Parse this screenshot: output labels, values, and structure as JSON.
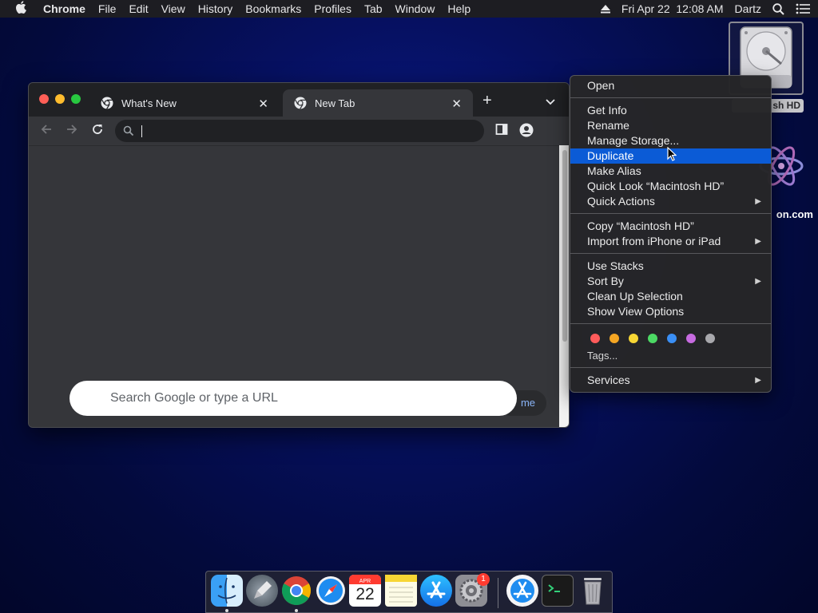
{
  "menubar": {
    "app_name": "Chrome",
    "items": [
      "File",
      "Edit",
      "View",
      "History",
      "Bookmarks",
      "Profiles",
      "Tab",
      "Window",
      "Help"
    ],
    "clock": "Fri Apr 22  12:08 AM",
    "user": "Dartz"
  },
  "desktop": {
    "hd_label": "sh HD",
    "atom_label": "on.com"
  },
  "chrome": {
    "tabs": [
      {
        "title": "What's New",
        "close": "✕"
      },
      {
        "title": "New Tab",
        "close": "✕"
      }
    ],
    "new_tab_symbol": "+",
    "omnibox_value": "",
    "ntp_search_placeholder": "Search Google or type a URL",
    "customize_text": "me"
  },
  "context_menu": {
    "group1": [
      "Open"
    ],
    "group2": [
      "Get Info",
      "Rename",
      "Manage Storage...",
      "Duplicate",
      "Make Alias",
      "Quick Look “Macintosh HD”",
      "Quick Actions"
    ],
    "group3": [
      "Copy “Macintosh HD”",
      "Import from iPhone or iPad"
    ],
    "group4": [
      "Use Stacks",
      "Sort By",
      "Clean Up Selection",
      "Show View Options"
    ],
    "tags_label": "Tags...",
    "services_label": "Services",
    "highlighted": "Duplicate",
    "tag_colors": [
      "#ff5b5b",
      "#f5a623",
      "#f7d634",
      "#4cd964",
      "#3a8ff5",
      "#c76be0",
      "#a8a8ac"
    ]
  },
  "dock": {
    "calendar_month": "APR",
    "calendar_day": "22",
    "settings_badge": "1"
  },
  "colors": {
    "accent": "#0b5bd6",
    "chrome_dark": "#35363a",
    "tabstrip": "#202124"
  }
}
